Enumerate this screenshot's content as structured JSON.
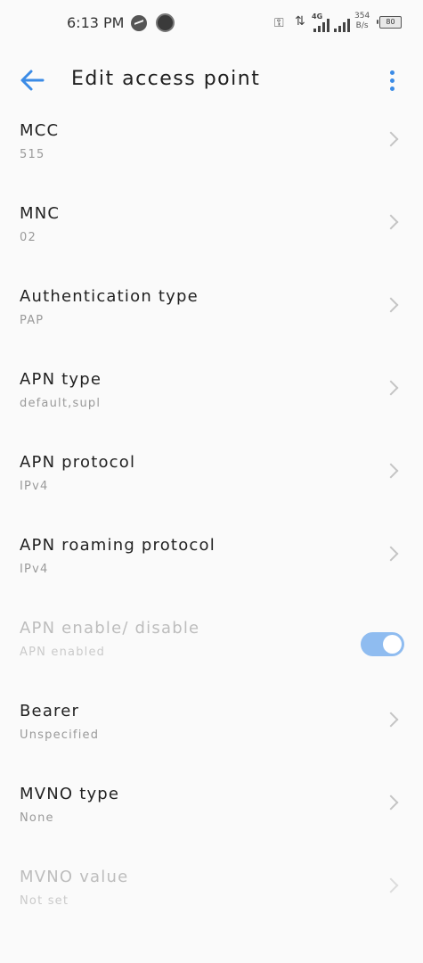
{
  "status_bar": {
    "time": "6:13 PM",
    "network_type": "4G",
    "speed_value": "354",
    "speed_unit": "B/s",
    "battery_level": "80",
    "icons": [
      "messenger-icon",
      "screen-record-icon",
      "vpn-key-icon",
      "data-arrows-icon",
      "signal-icon",
      "signal-icon-2",
      "battery-icon"
    ]
  },
  "app_bar": {
    "title": "Edit access point",
    "back_icon": "arrow-left-icon",
    "menu_icon": "more-vert-icon",
    "accent_color": "#3b8be6"
  },
  "settings": [
    {
      "title": "MCC",
      "value": "515",
      "enabled": true
    },
    {
      "title": "MNC",
      "value": "02",
      "enabled": true
    },
    {
      "title": "Authentication type",
      "value": "PAP",
      "enabled": true
    },
    {
      "title": "APN type",
      "value": "default,supl",
      "enabled": true
    },
    {
      "title": "APN protocol",
      "value": "IPv4",
      "enabled": true
    },
    {
      "title": "APN roaming protocol",
      "value": "IPv4",
      "enabled": true
    },
    {
      "title": "APN enable/ disable",
      "value": "APN enabled",
      "enabled": false,
      "toggle_on": true
    },
    {
      "title": "Bearer",
      "value": "Unspecified",
      "enabled": true
    },
    {
      "title": "MVNO type",
      "value": "None",
      "enabled": true
    },
    {
      "title": "MVNO value",
      "value": "Not set",
      "enabled": false
    }
  ]
}
